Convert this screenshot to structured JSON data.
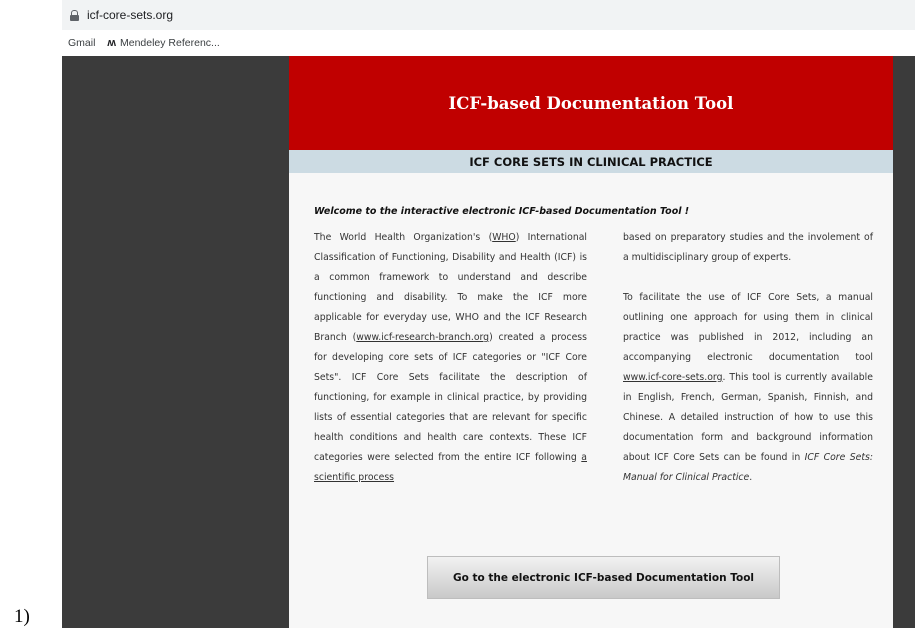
{
  "browser": {
    "url": "icf-core-sets.org",
    "bookmarks": [
      {
        "label": "Gmail"
      },
      {
        "label": "Mendeley Referenc..."
      }
    ]
  },
  "page": {
    "banner_title": "ICF-based Documentation Tool",
    "subtitle": "ICF CORE SETS IN CLINICAL PRACTICE",
    "welcome": "Welcome to the interactive electronic ICF-based Documentation Tool !",
    "col1": {
      "t1": "The World Health Organization's (",
      "link_who": "WHO",
      "t2": ") International Classification of Functioning, Disability and Health (ICF) is a common framework to understand and describe functioning and disability. To make the ICF more applicable for everyday use, WHO and the ICF Research Branch (",
      "link_branch": "www.icf-research-branch.org",
      "t3": ") created a process for developing core sets of ICF categories or \"ICF Core Sets\". ICF Core Sets facilitate the description of functioning, for example in clinical practice, by providing lists of essential categories that are relevant for specific health conditions and health care contexts. These ICF categories were selected from the entire ICF following ",
      "link_process": "a scientific process"
    },
    "col2": {
      "p1": "based on preparatory studies and the involement of a multidisciplinary group of experts.",
      "p2a": "To facilitate the use of ICF Core Sets, a manual outlining one approach for using them in clinical practice was published in 2012, including an accompanying electronic documentation tool ",
      "link_site": "www.icf-core-sets.org",
      "p2b": ". This tool is currently available in English, French, German, Spanish, Finnish, and Chinese. A detailed instruction of how to use this documentation form and background information about ICF Core Sets can be found in ",
      "p2c": "ICF Core Sets: Manual for Clinical Practice",
      "p2d": "."
    },
    "cta_label": "Go to the electronic ICF-based Documentation Tool"
  },
  "figure_label": "1)",
  "colors": {
    "banner": "#c00000",
    "subbar": "#ccdbe3",
    "side": "#3b3b3b"
  },
  "icons": {
    "lock": "lock-icon",
    "mendeley": "mendeley-icon"
  }
}
